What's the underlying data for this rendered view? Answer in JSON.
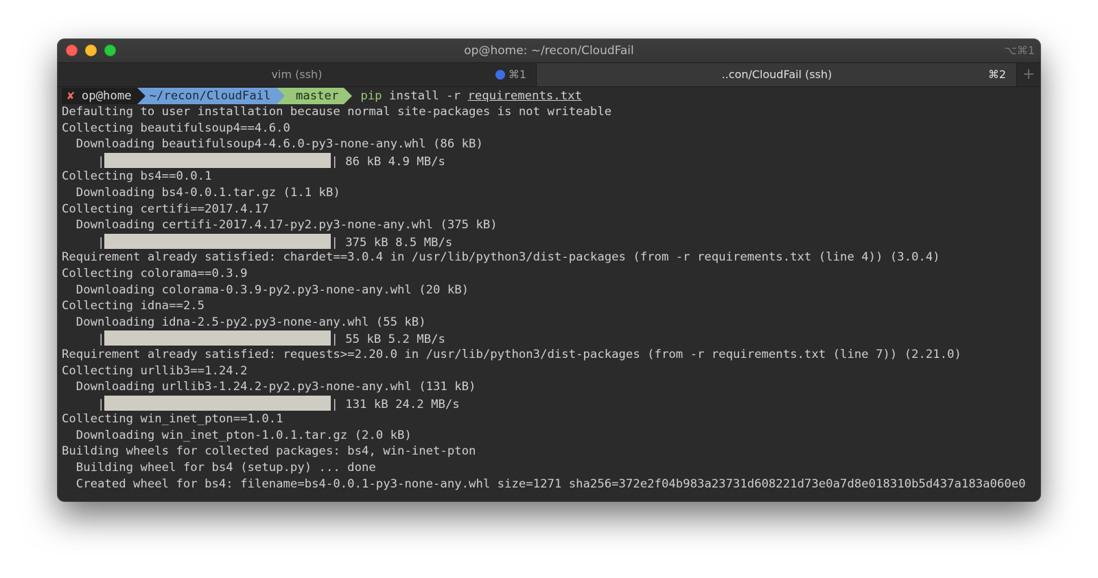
{
  "window": {
    "title": "op@home: ~/recon/CloudFail",
    "title_shortcut": "⌥⌘1"
  },
  "tabs": [
    {
      "label": "vim (ssh)",
      "shortcut": "⌘1",
      "active": false
    },
    {
      "label": "..con/CloudFail (ssh)",
      "shortcut": "⌘2",
      "active": true
    }
  ],
  "tab_add_label": "+",
  "prompt": {
    "status_icon": "✘",
    "user": "op@home",
    "path": "~/recon/CloudFail",
    "branch_icon": "",
    "branch": "master",
    "command_tool": "pip",
    "command_args": "install -r",
    "command_file": "requirements.txt"
  },
  "output": [
    {
      "text": "Defaulting to user installation because normal site-packages is not writeable"
    },
    {
      "text": "Collecting beautifulsoup4==4.6.0"
    },
    {
      "text": "  Downloading beautifulsoup4-4.6.0-py3-none-any.whl (86 kB)"
    },
    {
      "progress": 1.0,
      "suffix": "| 86 kB 4.9 MB/s"
    },
    {
      "text": "Collecting bs4==0.0.1"
    },
    {
      "text": "  Downloading bs4-0.0.1.tar.gz (1.1 kB)"
    },
    {
      "text": "Collecting certifi==2017.4.17"
    },
    {
      "text": "  Downloading certifi-2017.4.17-py2.py3-none-any.whl (375 kB)"
    },
    {
      "progress": 1.0,
      "suffix": "| 375 kB 8.5 MB/s"
    },
    {
      "text": "Requirement already satisfied: chardet==3.0.4 in /usr/lib/python3/dist-packages (from -r requirements.txt (line 4)) (3.0.4)"
    },
    {
      "text": "Collecting colorama==0.3.9"
    },
    {
      "text": "  Downloading colorama-0.3.9-py2.py3-none-any.whl (20 kB)"
    },
    {
      "text": "Collecting idna==2.5"
    },
    {
      "text": "  Downloading idna-2.5-py2.py3-none-any.whl (55 kB)"
    },
    {
      "progress": 1.0,
      "suffix": "| 55 kB 5.2 MB/s"
    },
    {
      "text": "Requirement already satisfied: requests>=2.20.0 in /usr/lib/python3/dist-packages (from -r requirements.txt (line 7)) (2.21.0)"
    },
    {
      "text": "Collecting urllib3==1.24.2"
    },
    {
      "text": "  Downloading urllib3-1.24.2-py2.py3-none-any.whl (131 kB)"
    },
    {
      "progress": 1.0,
      "suffix": "| 131 kB 24.2 MB/s"
    },
    {
      "text": "Collecting win_inet_pton==1.0.1"
    },
    {
      "text": "  Downloading win_inet_pton-1.0.1.tar.gz (2.0 kB)"
    },
    {
      "text": "Building wheels for collected packages: bs4, win-inet-pton"
    },
    {
      "text": "  Building wheel for bs4 (setup.py) ... done"
    },
    {
      "text": "  Created wheel for bs4: filename=bs4-0.0.1-py3-none-any.whl size=1271 sha256=372e2f04b983a23731d608221d73e0a7d8e018310b5d437a183a060e0"
    }
  ],
  "colors": {
    "terminal_bg": "#2b2b2b",
    "path_segment": "#6f9fd8",
    "git_segment": "#9ac77a",
    "error_x": "#ff6b5a",
    "progress_fill": "#cfcdc3"
  }
}
